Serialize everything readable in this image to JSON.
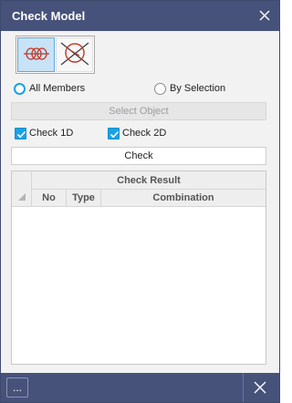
{
  "window": {
    "title": "Check Model"
  },
  "modes": [
    {
      "icon": "member-check-icon",
      "selected": true
    },
    {
      "icon": "plate-check-icon",
      "selected": false
    }
  ],
  "scope": {
    "all_members": "All Members",
    "by_selection": "By Selection",
    "selected": "All Members"
  },
  "select_object_label": "Select Object",
  "checks": {
    "check_1d": "Check 1D",
    "check_2d": "Check 2D",
    "check_1d_checked": true,
    "check_2d_checked": true
  },
  "check_button_label": "Check",
  "result_grid": {
    "title": "Check Result",
    "columns": [
      "No",
      "Type",
      "Combination"
    ],
    "rows": []
  },
  "statusbar": {
    "more_label": "..."
  },
  "colors": {
    "title_bar": "#46527a",
    "accent": "#1ba1e2",
    "selected_mode": "#c8e3f6"
  }
}
